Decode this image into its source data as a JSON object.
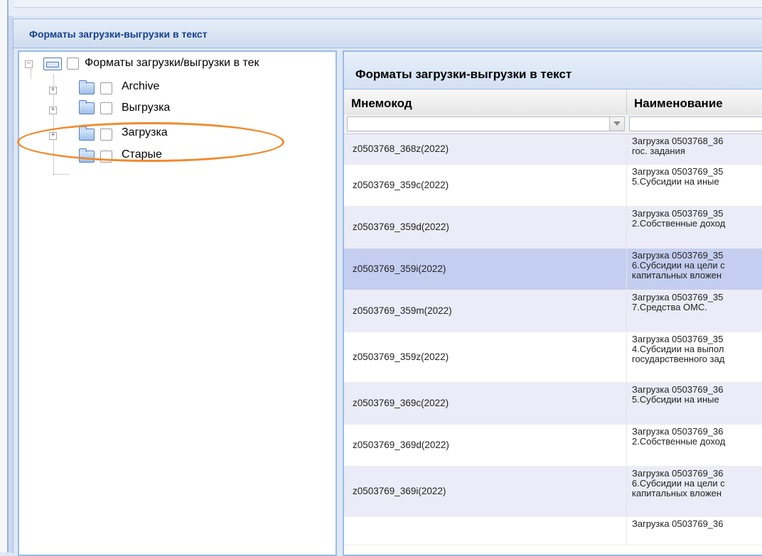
{
  "window": {
    "title": "Форматы загрузки-выгрузки в текст"
  },
  "tree": {
    "root": {
      "label": "Форматы загрузки/выгрузки в тек",
      "expander": "−"
    },
    "items": [
      {
        "label": "Archive",
        "expander": "+"
      },
      {
        "label": "Выгрузка",
        "expander": "+"
      },
      {
        "label": "Загрузка",
        "expander": "+"
      },
      {
        "label": "Старые",
        "expander": ""
      }
    ]
  },
  "grid": {
    "title": "Форматы загрузки-выгрузки в текст",
    "columns": [
      "Мнемокод",
      "Наименование"
    ],
    "filter": {
      "mnemocode": "",
      "name": ""
    },
    "rows": [
      {
        "code": "z0503768_368z(2022)",
        "name": "Загрузка 0503768_36\nгос. задания",
        "style": "alt"
      },
      {
        "code": "z0503769_359c(2022)",
        "name": "Загрузка 0503769_35\n5.Субсидии на иные",
        "style": ""
      },
      {
        "code": "z0503769_359d(2022)",
        "name": "Загрузка 0503769_35\n2.Собственные доход",
        "style": "alt"
      },
      {
        "code": "z0503769_359i(2022)",
        "name": "Загрузка 0503769_35\n6.Субсидии на цели с\nкапитальных вложен",
        "style": "sel"
      },
      {
        "code": "z0503769_359m(2022)",
        "name": "Загрузка 0503769_35\n7.Средства ОМС.",
        "style": "alt"
      },
      {
        "code": "z0503769_359z(2022)",
        "name": "Загрузка 0503769_35\n4.Субсидии на выпол\nгосударственного зад",
        "style": ""
      },
      {
        "code": "z0503769_369c(2022)",
        "name": "Загрузка 0503769_36\n5.Субсидии на иные",
        "style": "alt"
      },
      {
        "code": "z0503769_369d(2022)",
        "name": "Загрузка 0503769_36\n2.Собственные доход",
        "style": ""
      },
      {
        "code": "z0503769_369i(2022)",
        "name": "Загрузка 0503769_36\n6.Субсидии на цели с\nкапитальных вложен",
        "style": "alt"
      },
      {
        "code": "",
        "name": "Загрузка 0503769_36",
        "style": ""
      }
    ]
  },
  "colors": {
    "highlight": "#f08a2d",
    "header_text": "#15428b",
    "border": "#99bbe8"
  }
}
